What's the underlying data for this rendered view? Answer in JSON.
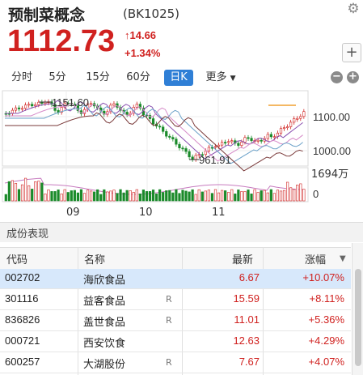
{
  "header": {
    "title": "预制菜概念",
    "code": "(BK1025)",
    "price": "1112.73",
    "change": "14.66",
    "change_pct": "+1.34%"
  },
  "tabs": [
    "分时",
    "5分",
    "15分",
    "60分",
    "日K",
    "更多"
  ],
  "active_tab": "日K",
  "chart": {
    "high_label": "1151.60",
    "low_label": "961.91",
    "y_labels": [
      "1100.00",
      "1000.00"
    ],
    "vol_label": "1694万",
    "vol_zero": "0",
    "x_labels": [
      "09",
      "10",
      "11"
    ]
  },
  "section_title": "成份表现",
  "table": {
    "headers": [
      "代码",
      "名称",
      "最新",
      "涨幅"
    ],
    "rows": [
      {
        "code": "002702",
        "name": "海欣食品",
        "flag": "",
        "price": "6.67",
        "pct": "+10.07%"
      },
      {
        "code": "301116",
        "name": "益客食品",
        "flag": "R",
        "price": "15.59",
        "pct": "+8.11%"
      },
      {
        "code": "836826",
        "name": "盖世食品",
        "flag": "R",
        "price": "11.01",
        "pct": "+5.36%"
      },
      {
        "code": "000721",
        "name": "西安饮食",
        "flag": "",
        "price": "12.63",
        "pct": "+4.29%"
      },
      {
        "code": "600257",
        "name": "大湖股份",
        "flag": "R",
        "price": "7.67",
        "pct": "+4.07%"
      }
    ]
  },
  "colors": {
    "up": "#d0211f",
    "down": "#1a8a2a",
    "accent": "#2f7fd6"
  }
}
